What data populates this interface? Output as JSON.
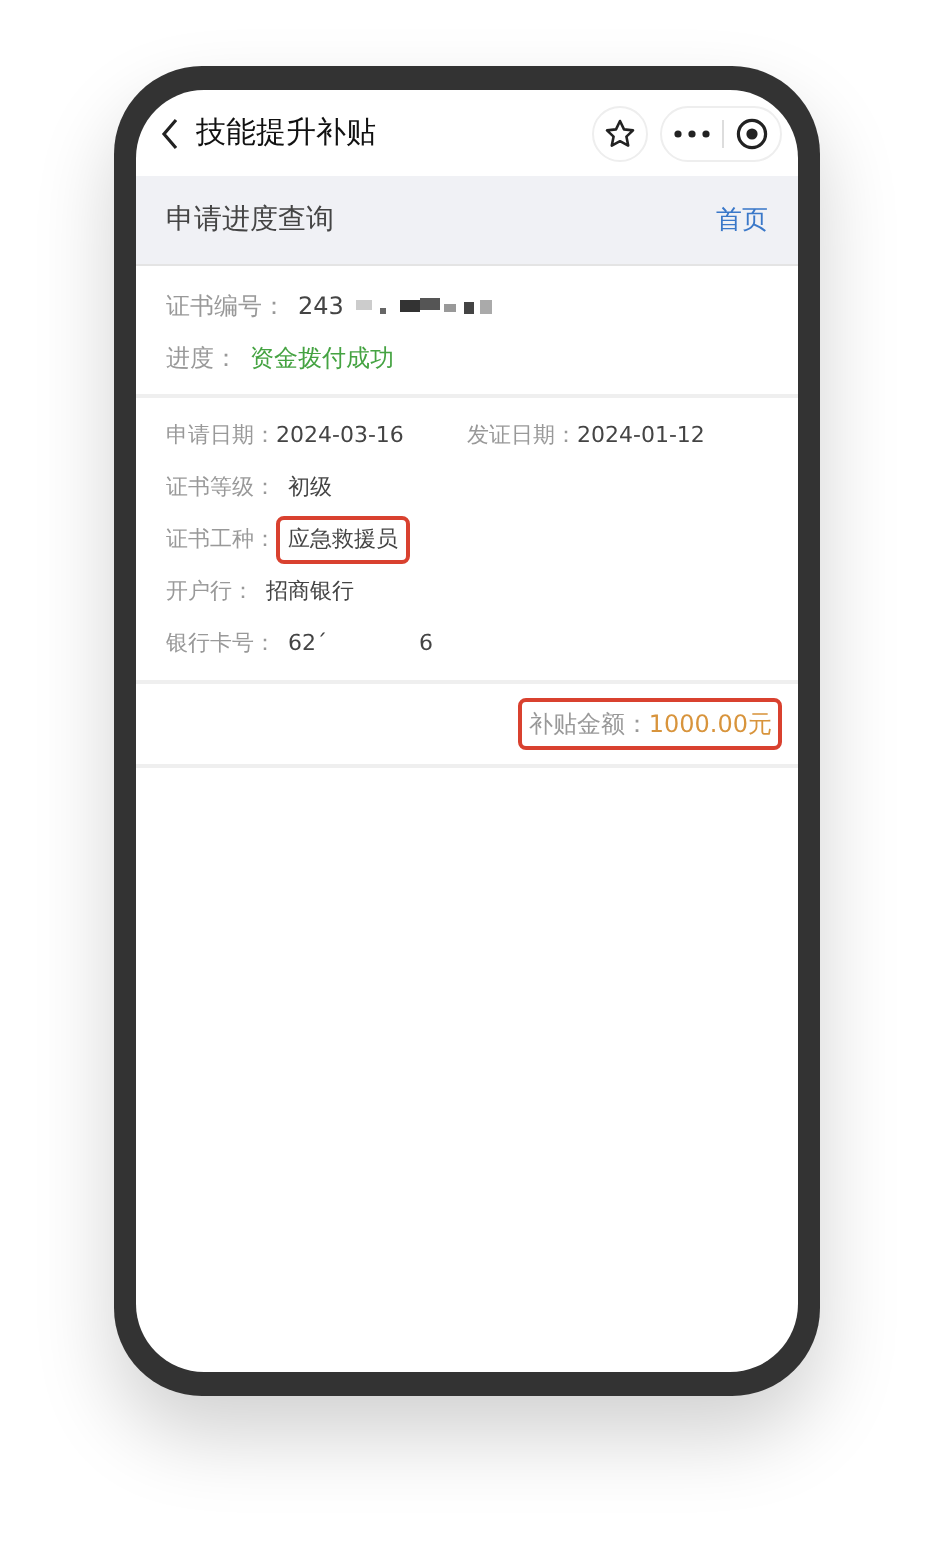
{
  "nav": {
    "title": "技能提升补贴"
  },
  "header": {
    "title": "申请进度查询",
    "link": "首页"
  },
  "summary": [
    {
      "label": "证书编号：",
      "value": "243",
      "redacted": true,
      "kind": "plain"
    },
    {
      "label": "进度：",
      "value": "资金拨付成功",
      "redacted": false,
      "kind": "status"
    }
  ],
  "details": {
    "date_fields": [
      {
        "label": "申请日期：",
        "value": "2024-03-16"
      },
      {
        "label": "发证日期：",
        "value": "2024-01-12"
      }
    ],
    "fields": [
      {
        "label": "证书等级：",
        "value": "初级",
        "highlighted": false
      },
      {
        "label": "证书工种：",
        "value": "应急救援员",
        "highlighted": true
      },
      {
        "label": "开户行：",
        "value": "招商银行",
        "highlighted": false
      },
      {
        "label": "银行卡号：",
        "value": "62´",
        "value_end": "6",
        "highlighted": false
      }
    ]
  },
  "amount": {
    "label": "补贴金额：",
    "value": "1000.00元",
    "highlighted": true
  }
}
